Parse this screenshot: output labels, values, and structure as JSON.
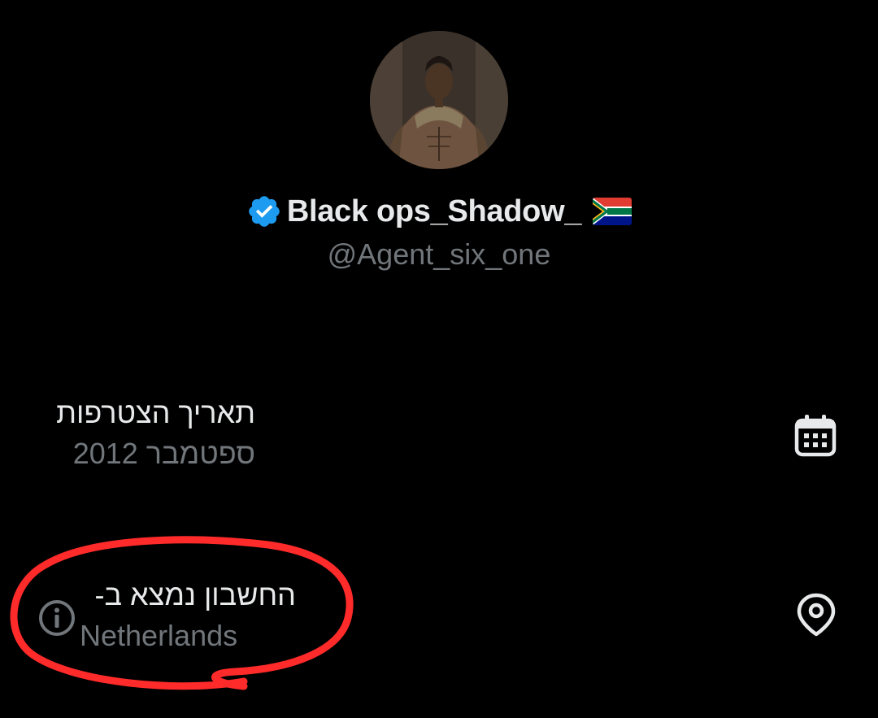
{
  "profile": {
    "display_name": "Black ops_Shadow_",
    "handle": "@Agent_six_one",
    "verified_icon": "verified-badge-icon",
    "flag_icon": "south-africa-flag-icon"
  },
  "join_date": {
    "label": "תאריך הצטרפות",
    "value": "ספטמבר 2012",
    "icon": "calendar-icon"
  },
  "location": {
    "label": "החשבון נמצא ב-",
    "value": "Netherlands",
    "icon": "location-pin-icon",
    "info_icon": "info-icon"
  },
  "colors": {
    "background": "#000000",
    "primary_text": "#e7e9ea",
    "secondary_text": "#71767b",
    "verified_blue": "#1d9bf0",
    "annotation_red": "#ff2a2a"
  }
}
